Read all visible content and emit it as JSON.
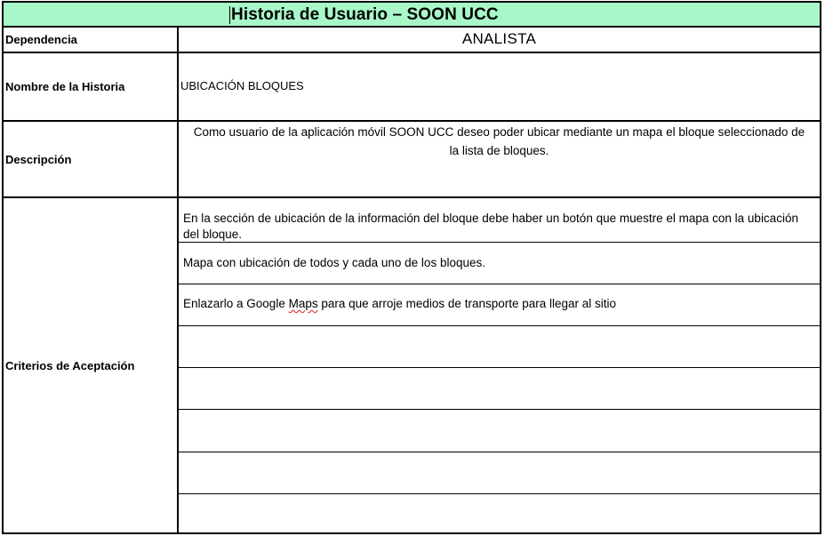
{
  "title": "Historia de Usuario – SOON UCC",
  "rows": {
    "dependencia": {
      "label": "Dependencia",
      "value": "ANALISTA"
    },
    "nombre": {
      "label": "Nombre de la Historia",
      "value": "UBICACIÓN BLOQUES"
    },
    "descripcion": {
      "label": "Descripción",
      "value": "Como usuario de la aplicación móvil SOON UCC deseo poder ubicar mediante un mapa el bloque seleccionado de la lista de bloques."
    },
    "criterios": {
      "label": "Criterios de Aceptación",
      "items": [
        "En la sección de ubicación de la información del bloque debe haber un botón que muestre el mapa con la ubicación del bloque.",
        "Mapa con ubicación de todos y cada uno de los bloques.",
        "",
        "",
        "",
        "",
        ""
      ],
      "item3": {
        "before": "Enlazarlo a Google ",
        "flagged": "Maps",
        "after": " para que arroje medios de transporte para llegar al sitio"
      }
    }
  },
  "colors": {
    "title_background": "#a8f7c8",
    "border": "#000000",
    "spellcheck_underline": "#d42020"
  }
}
